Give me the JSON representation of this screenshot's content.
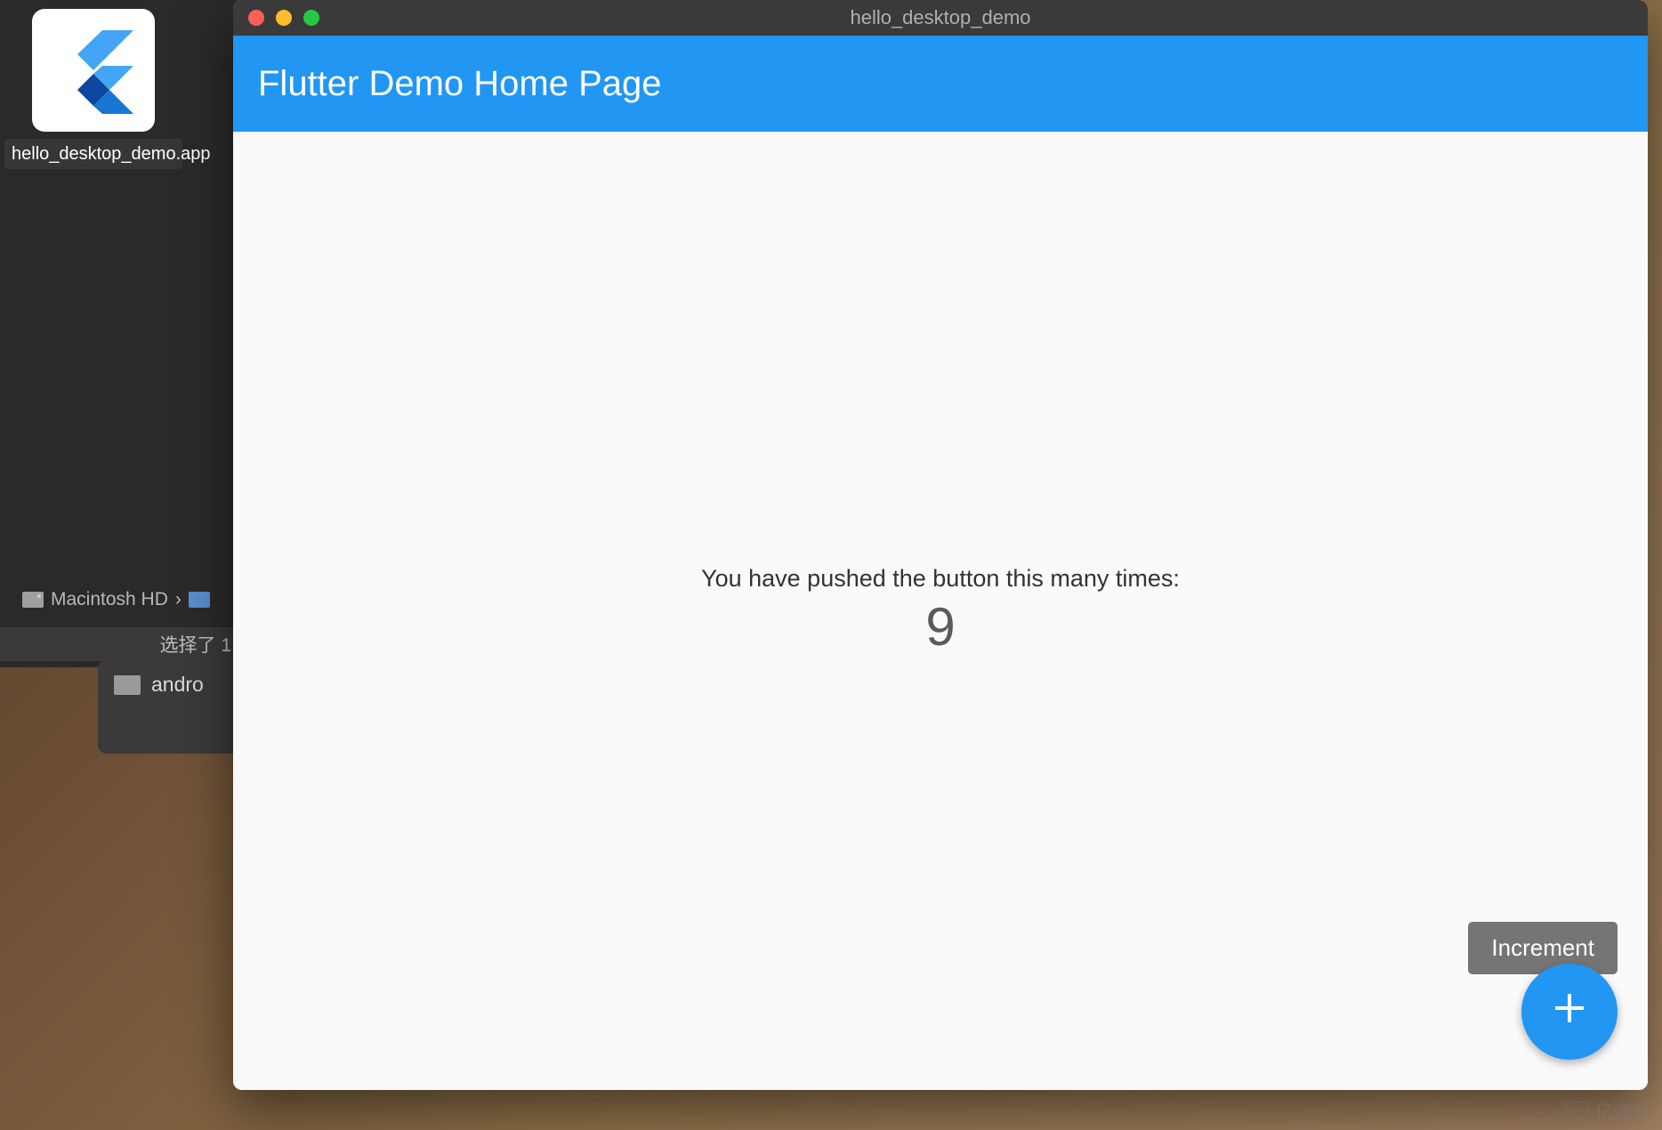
{
  "desktop": {
    "icon_label": "hello_desktop_demo.app",
    "flutter_icon": "flutter-logo"
  },
  "finder": {
    "path_disk": "Macintosh HD",
    "path_separator": "›",
    "selection_text": "选择了 1",
    "lower_item": "andro"
  },
  "window": {
    "title": "hello_desktop_demo"
  },
  "app": {
    "header_title": "Flutter Demo Home Page",
    "body_text": "You have pushed the button this many times:",
    "counter": "9",
    "tooltip": "Increment",
    "fab_icon": "add"
  },
  "watermark": {
    "text": "亿速云"
  },
  "colors": {
    "primary": "#2196f3",
    "surface": "#fafafa",
    "titlebar": "#3a3a3a",
    "tooltip_bg": "#757575"
  }
}
